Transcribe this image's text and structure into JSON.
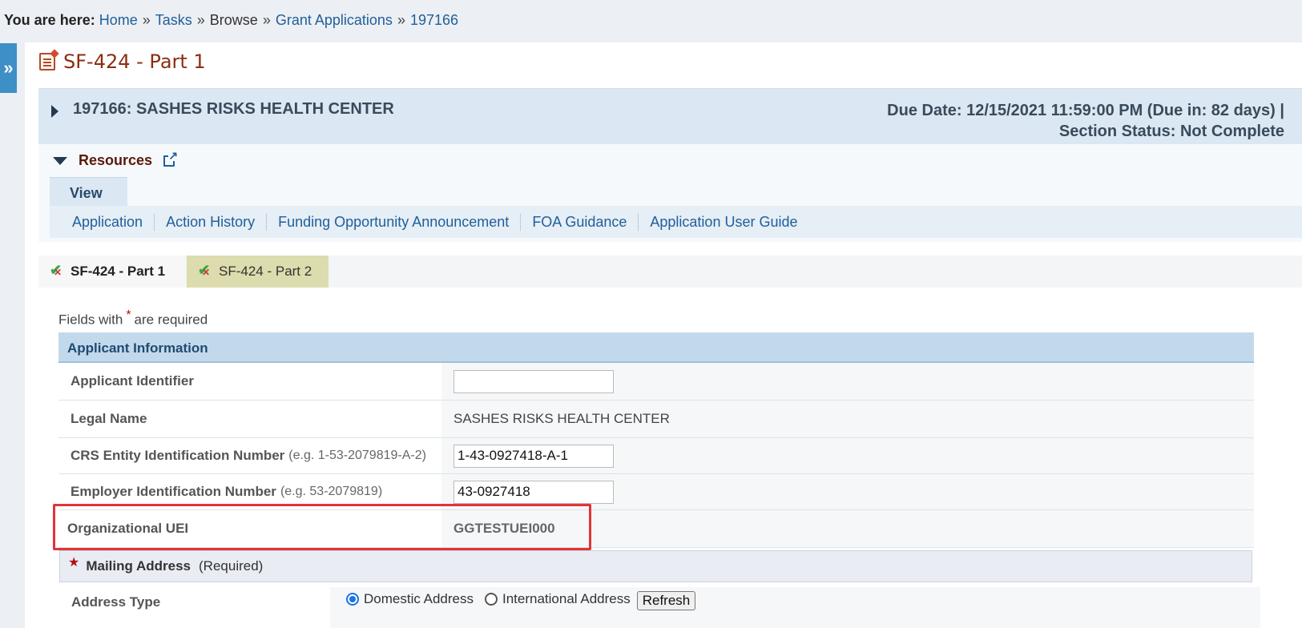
{
  "breadcrumb": {
    "prefix": "You are here:",
    "items": [
      "Home",
      "Tasks",
      "Browse",
      "Grant Applications",
      "197166"
    ],
    "separator": "»"
  },
  "sidebar_toggle": {
    "icon": "double-chevron-right-icon",
    "glyph": "»"
  },
  "page": {
    "title": "SF-424 - Part 1"
  },
  "application_header": {
    "title": "197166: SASHES RISKS HEALTH CENTER",
    "due_line": "Due Date: 12/15/2021 11:59:00 PM (Due in: 82 days) |",
    "status_line": "Section Status: Not Complete"
  },
  "resources": {
    "label": "Resources",
    "view_tab": "View",
    "links": [
      "Application",
      "Action History",
      "Funding Opportunity Announcement",
      "FOA Guidance",
      "Application User Guide"
    ]
  },
  "form_tabs": [
    "SF-424 - Part 1",
    "SF-424 - Part 2"
  ],
  "required_note": {
    "before": "Fields with",
    "star": "*",
    "after": "are required"
  },
  "applicant_section": {
    "title": "Applicant Information",
    "rows": [
      {
        "label": "Applicant Identifier",
        "hint": "",
        "value": ""
      },
      {
        "label": "Legal Name",
        "hint": "",
        "value": "SASHES RISKS HEALTH CENTER"
      },
      {
        "label": "CRS Entity Identification Number",
        "hint": "(e.g. 1-53-2079819-A-2)",
        "value": "1-43-0927418-A-1"
      },
      {
        "label": "Employer Identification Number",
        "hint": "(e.g. 53-2079819)",
        "value": "43-0927418"
      },
      {
        "label": "Organizational UEI",
        "hint": "",
        "value": "GGTESTUEI000"
      }
    ]
  },
  "mailing_address": {
    "title": "Mailing Address",
    "required": "(Required)",
    "address_type_label": "Address Type",
    "options": [
      "Domestic Address",
      "International Address"
    ],
    "selected": "Domestic Address",
    "refresh_label": "Refresh"
  },
  "colors": {
    "title_brown": "#8b2e12",
    "link_blue": "#1f5f9a",
    "highlight_red": "#e0343a",
    "section_blue": "#c2d9ec"
  }
}
